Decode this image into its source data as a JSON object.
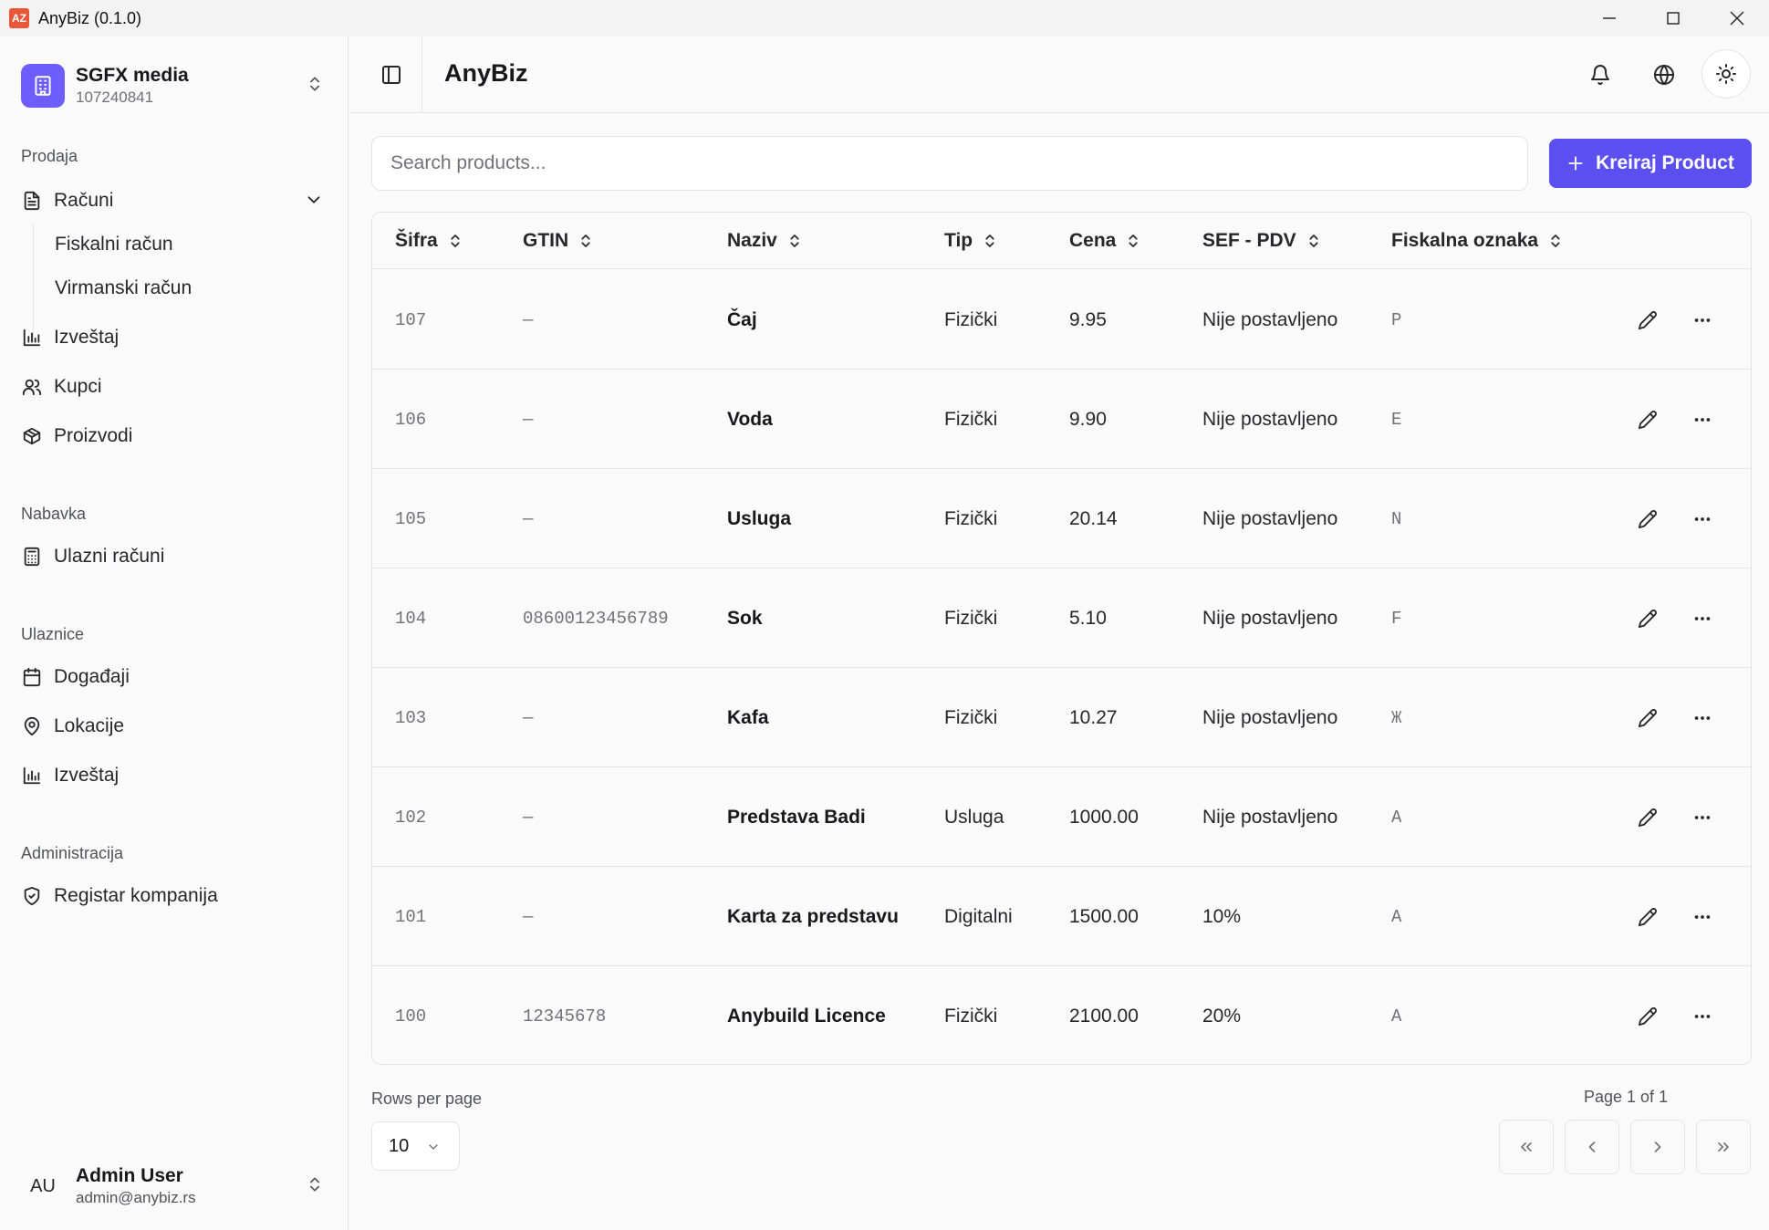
{
  "window": {
    "logo_text": "AZ",
    "title": "AnyBiz (0.1.0)"
  },
  "org": {
    "name": "SGFX media",
    "id": "107240841"
  },
  "sidebar": {
    "sections": [
      {
        "label": "Prodaja"
      },
      {
        "label": "Nabavka"
      },
      {
        "label": "Ulaznice"
      },
      {
        "label": "Administracija"
      }
    ],
    "items": {
      "racuni": "Računi",
      "fiskalni": "Fiskalni račun",
      "virmanski": "Virmanski račun",
      "izvestaj": "Izveštaj",
      "kupci": "Kupci",
      "proizvodi": "Proizvodi",
      "ulazni": "Ulazni računi",
      "dogadjaji": "Događaji",
      "lokacije": "Lokacije",
      "izvestaj2": "Izveštaj",
      "registar": "Registar kompanija"
    }
  },
  "user": {
    "initials": "AU",
    "name": "Admin User",
    "email": "admin@anybiz.rs"
  },
  "header": {
    "title": "AnyBiz"
  },
  "toolbar": {
    "search_placeholder": "Search products...",
    "create_label": "Kreiraj Product"
  },
  "table": {
    "columns": [
      "Šifra",
      "GTIN",
      "Naziv",
      "Tip",
      "Cena",
      "SEF - PDV",
      "Fiskalna oznaka"
    ],
    "rows": [
      {
        "sifra": "107",
        "gtin": "—",
        "naziv": "Čaj",
        "tip": "Fizički",
        "cena": "9.95",
        "pdv": "Nije postavljeno",
        "oznaka": "P"
      },
      {
        "sifra": "106",
        "gtin": "—",
        "naziv": "Voda",
        "tip": "Fizički",
        "cena": "9.90",
        "pdv": "Nije postavljeno",
        "oznaka": "E"
      },
      {
        "sifra": "105",
        "gtin": "—",
        "naziv": "Usluga",
        "tip": "Fizički",
        "cena": "20.14",
        "pdv": "Nije postavljeno",
        "oznaka": "N"
      },
      {
        "sifra": "104",
        "gtin": "08600123456789",
        "naziv": "Sok",
        "tip": "Fizički",
        "cena": "5.10",
        "pdv": "Nije postavljeno",
        "oznaka": "F"
      },
      {
        "sifra": "103",
        "gtin": "—",
        "naziv": "Kafa",
        "tip": "Fizički",
        "cena": "10.27",
        "pdv": "Nije postavljeno",
        "oznaka": "Ж"
      },
      {
        "sifra": "102",
        "gtin": "—",
        "naziv": "Predstava Badi",
        "tip": "Usluga",
        "cena": "1000.00",
        "pdv": "Nije postavljeno",
        "oznaka": "A"
      },
      {
        "sifra": "101",
        "gtin": "—",
        "naziv": "Karta za predstavu",
        "tip": "Digitalni",
        "cena": "1500.00",
        "pdv": "10%",
        "oznaka": "A"
      },
      {
        "sifra": "100",
        "gtin": "12345678",
        "naziv": "Anybuild Licence",
        "tip": "Fizički",
        "cena": "2100.00",
        "pdv": "20%",
        "oznaka": "A"
      }
    ]
  },
  "pagination": {
    "rows_label": "Rows per page",
    "rows_value": "10",
    "page_label": "Page 1 of 1"
  }
}
